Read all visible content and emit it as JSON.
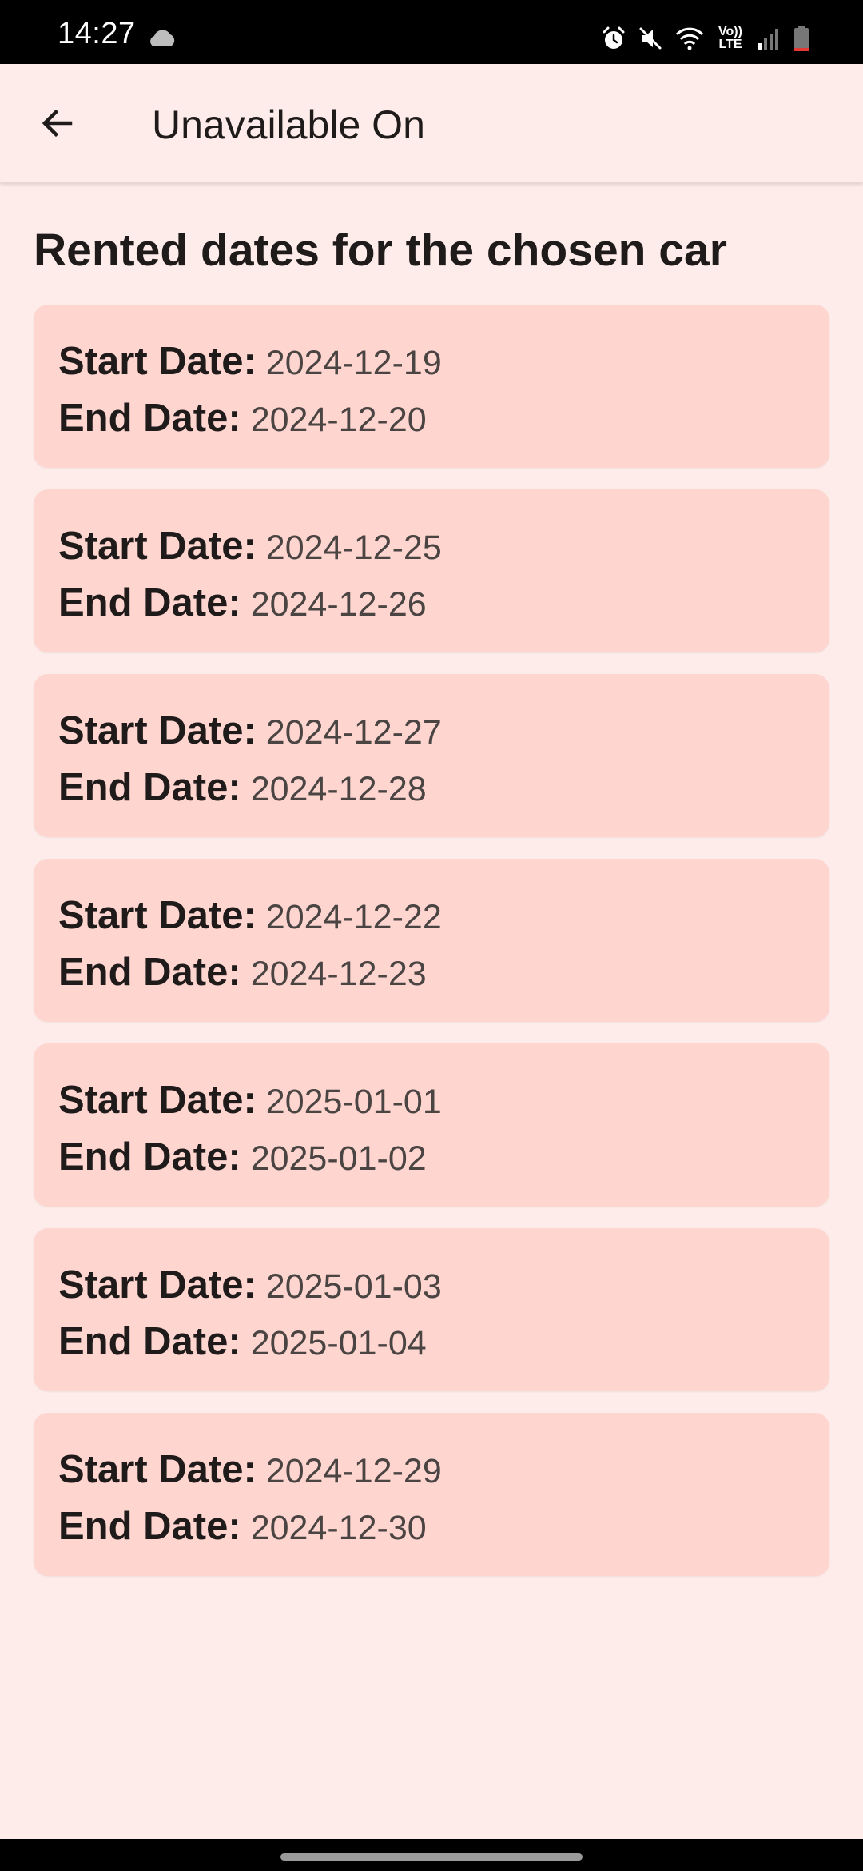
{
  "status_bar": {
    "time": "14:27",
    "volte_label": "Vo)) LTE",
    "icons": [
      "cloud-icon",
      "alarm-icon",
      "mute-icon",
      "wifi-icon",
      "volte-icon",
      "signal-icon",
      "battery-icon"
    ]
  },
  "app_bar": {
    "back_icon": "arrow-left-icon",
    "title": "Unavailable On"
  },
  "main": {
    "heading": "Rented dates for the chosen car",
    "start_label": "Start Date:",
    "end_label": "End Date:",
    "rentals": [
      {
        "start": "2024-12-19",
        "end": "2024-12-20"
      },
      {
        "start": "2024-12-25",
        "end": "2024-12-26"
      },
      {
        "start": "2024-12-27",
        "end": "2024-12-28"
      },
      {
        "start": "2024-12-22",
        "end": "2024-12-23"
      },
      {
        "start": "2025-01-01",
        "end": "2025-01-02"
      },
      {
        "start": "2025-01-03",
        "end": "2025-01-04"
      },
      {
        "start": "2024-12-29",
        "end": "2024-12-30"
      }
    ]
  },
  "colors": {
    "background": "#fdecea",
    "card": "#ffd5d0",
    "text": "#1f1b1a",
    "secondary_text": "#4a4443"
  }
}
